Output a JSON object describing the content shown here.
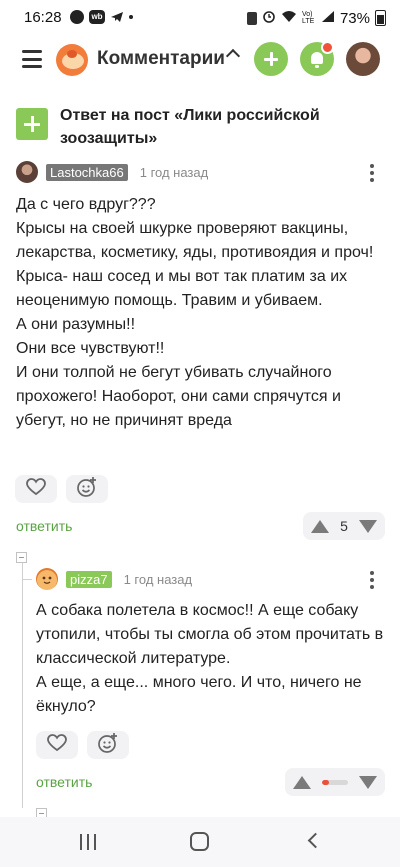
{
  "status_bar": {
    "time": "16:28",
    "wb_icon_text": "wb",
    "battery_text": "73%",
    "network_text": "Vo) LTE"
  },
  "header": {
    "title": "Комментарии"
  },
  "post": {
    "title": "Ответ на пост «Лики российской зоозащиты»"
  },
  "comments": [
    {
      "username": "Lastochka66",
      "badge_color": "#777777",
      "time": "1 год назад",
      "lines": [
        "Да с чего вдруг???",
        "Крысы на своей шкурке проверяют вакцины, лекарства, косметику, яды, противоядия и проч!",
        "Крыса- наш сосед и мы вот так платим за их неоценимую помощь. Травим и убиваем.",
        "А они разумны!!",
        "Они все чувствуют!!",
        "И они толпой не бегут убивать случайного прохожего! Наоборот, они сами спрячутся и убегут, но не причинят вреда"
      ],
      "reply_label": "ответить",
      "rating": "5"
    },
    {
      "username": "pizza7",
      "badge_color": "#8ac858",
      "time": "1 год назад",
      "lines": [
        "А собака полетела в космос!! А еще собаку утопили, чтобы ты смогла об этом прочитать в классической литературе.",
        "А еще, а еще... много чего. И что, ничего не ёкнуло?"
      ],
      "reply_label": "ответить",
      "rating_bar_fraction": 0.25
    }
  ],
  "colors": {
    "accent_green": "#8ac858",
    "link_green": "#5aa345",
    "notification_red": "#f0533a"
  }
}
